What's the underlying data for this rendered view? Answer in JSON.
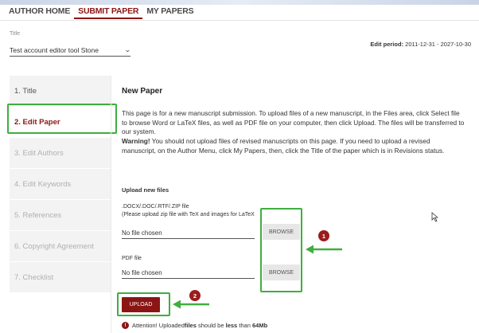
{
  "nav": {
    "items": [
      {
        "label": "AUTHOR HOME",
        "active": false
      },
      {
        "label": "SUBMIT PAPER",
        "active": true
      },
      {
        "label": "MY PAPERS",
        "active": false
      }
    ]
  },
  "title_field": {
    "label": "Title",
    "value": "Test account editor tool Stone"
  },
  "edit_period": {
    "label": "Edit period:",
    "value": "2011-12-31 - 2027-10-30"
  },
  "sidebar": {
    "items": [
      {
        "label": "1. Title",
        "state": "done"
      },
      {
        "label": "2. Edit Paper",
        "state": "active"
      },
      {
        "label": "3. Edit Authors",
        "state": "disabled"
      },
      {
        "label": "4. Edit Keywords",
        "state": "disabled"
      },
      {
        "label": "5. References",
        "state": "disabled"
      },
      {
        "label": "6. Copyright Agreement",
        "state": "disabled"
      },
      {
        "label": "7. Checklist",
        "state": "disabled"
      }
    ]
  },
  "content": {
    "title": "New Paper",
    "intro": "This page is for a new manuscript submission. To upload files of a new manuscript, in the Files area, click Select file to browse Word or LaTeX files, as well as PDF file on your computer, then click Upload. The files will be transferred to our system.",
    "warning_label": "Warning!",
    "warning_text": " You should not upload files of revised manuscripts on this page. If you need to upload a revised manuscript, on the Author Menu, click My Papers, then, click the Title of the paper which is in Revisions status.",
    "upload_heading": "Upload new files",
    "word_file": {
      "label": ".DOCX/.DOC/.RTF/.ZIP file",
      "hint": "(Please upload zip file with TeX and images for LaTeX",
      "value": "No file chosen",
      "button": "BROWSE"
    },
    "pdf_file": {
      "label": "PDF file",
      "value": "No file chosen",
      "button": "BROWSE"
    },
    "upload_button": "UPLOAD",
    "attention": {
      "prefix": "Attention! Uploaded ",
      "files": "files",
      "middle": " should be ",
      "less": "less",
      "than": " than ",
      "size": "64Mb"
    }
  },
  "annotations": {
    "badge1": "1",
    "badge2": "2",
    "highlight_color": "#3fae3f",
    "badge_color": "#9b1c1c"
  },
  "colors": {
    "accent": "#8b1515",
    "sidebar_bg": "#f3f3f3",
    "button_gray": "#e7e7e7"
  }
}
